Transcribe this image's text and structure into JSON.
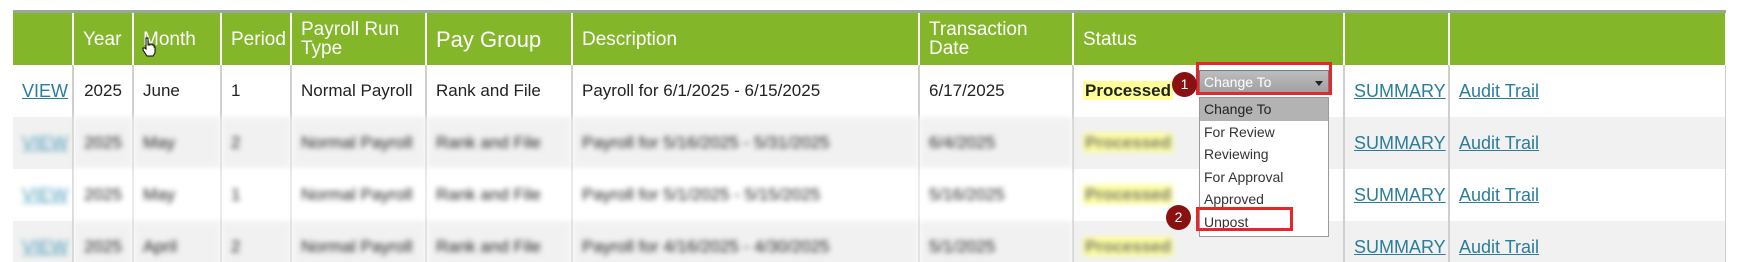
{
  "columns": [
    {
      "label": ""
    },
    {
      "label": "Year"
    },
    {
      "label": "Month"
    },
    {
      "label": "Period"
    },
    {
      "label": "Payroll Run Type"
    },
    {
      "label": "Pay Group"
    },
    {
      "label": "Description"
    },
    {
      "label": "Transaction Date"
    },
    {
      "label": "Status"
    },
    {
      "label": ""
    },
    {
      "label": ""
    }
  ],
  "rows": [
    {
      "view": "VIEW",
      "year": "2025",
      "month": "June",
      "period": "1",
      "run_type": "Normal Payroll",
      "pay_group": "Rank and File",
      "description": "Payroll for 6/1/2025 - 6/15/2025",
      "transaction_date": "6/17/2025",
      "status": "Processed",
      "summary": "SUMMARY",
      "audit": "Audit Trail"
    },
    {
      "view": "VIEW",
      "year": "2025",
      "month": "May",
      "period": "2",
      "run_type": "Normal Payroll",
      "pay_group": "Rank and File",
      "description": "Payroll for 5/16/2025 - 5/31/2025",
      "transaction_date": "6/4/2025",
      "status": "Processed",
      "summary": "SUMMARY",
      "audit": "Audit Trail"
    },
    {
      "view": "VIEW",
      "year": "2025",
      "month": "May",
      "period": "1",
      "run_type": "Normal Payroll",
      "pay_group": "Rank and File",
      "description": "Payroll for 5/1/2025 - 5/15/2025",
      "transaction_date": "5/16/2025",
      "status": "Processed",
      "summary": "SUMMARY",
      "audit": "Audit Trail"
    },
    {
      "view": "VIEW",
      "year": "2025",
      "month": "April",
      "period": "2",
      "run_type": "Normal Payroll",
      "pay_group": "Rank and File",
      "description": "Payroll for 4/16/2025 - 4/30/2025",
      "transaction_date": "5/1/2025",
      "status": "Processed",
      "summary": "SUMMARY",
      "audit": "Audit Trail"
    }
  ],
  "status_select": {
    "value": "Change To",
    "options": [
      "Change To",
      "For Review",
      "Reviewing",
      "For Approval",
      "Approved",
      "Unpost"
    ]
  },
  "annotations": {
    "step1": "1",
    "step2": "2",
    "highlight_color": "#e5262c",
    "badge_color": "#8a1111"
  },
  "colors": {
    "header_bg": "#84b62a",
    "link": "#2a7d9c",
    "status_highlight": "#ffff9a"
  },
  "icons": {
    "cursor": "hand-pointer-icon",
    "dropdown": "caret-down-icon"
  }
}
